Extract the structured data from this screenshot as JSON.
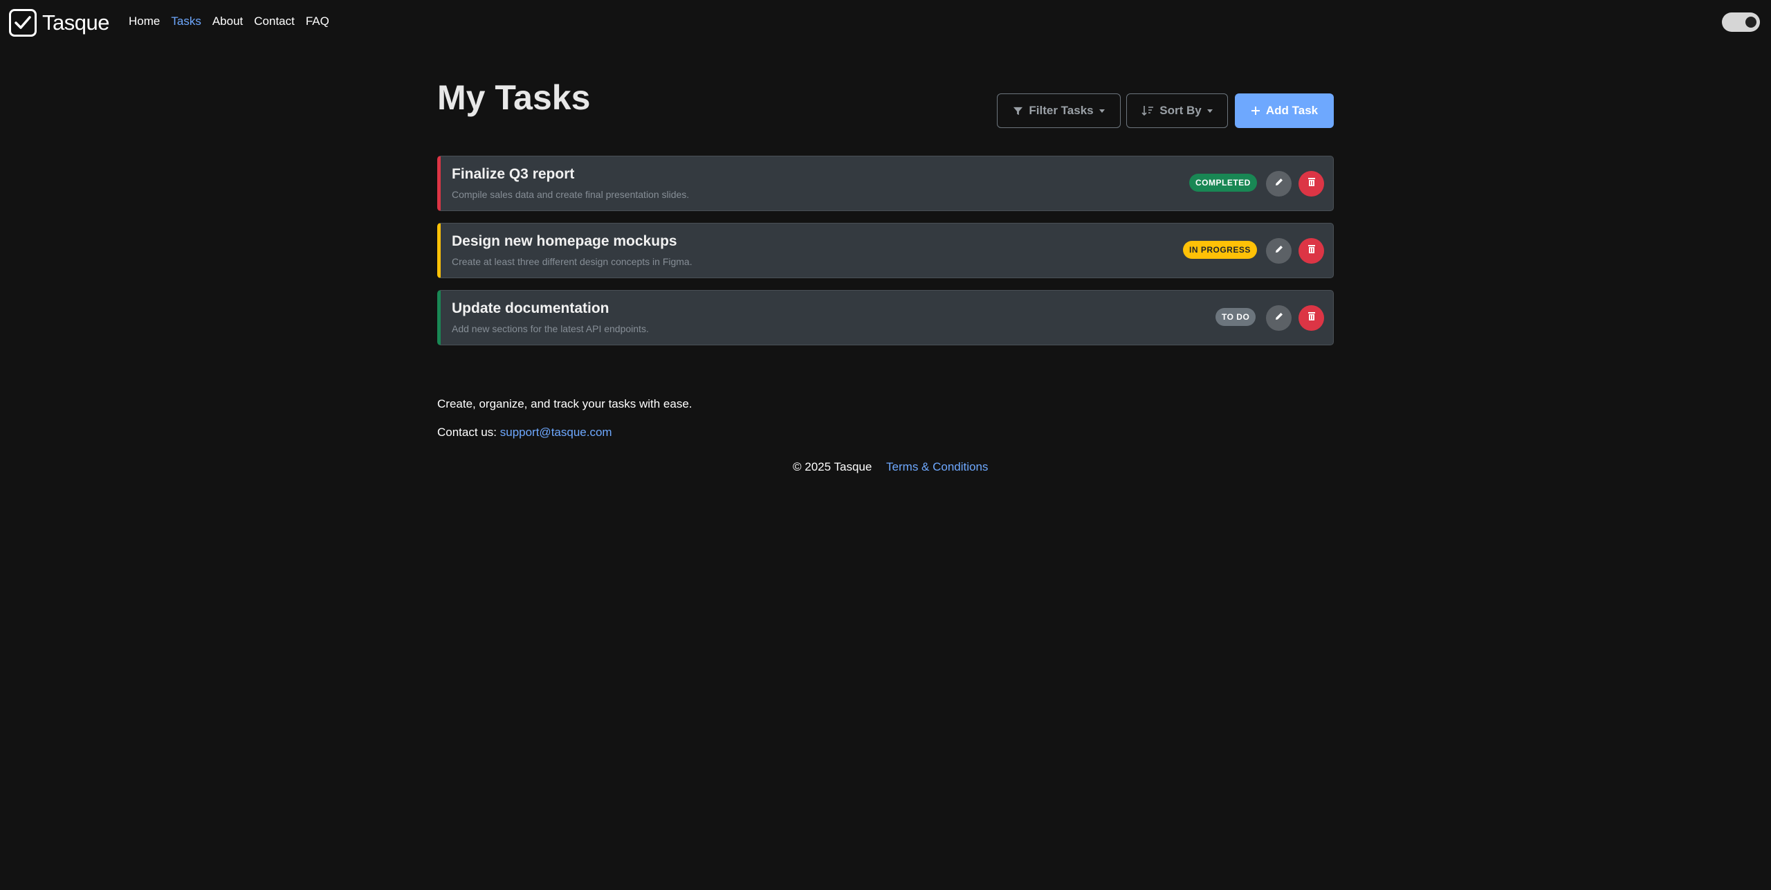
{
  "brand": {
    "name": "Tasque"
  },
  "nav": {
    "items": [
      {
        "label": "Home",
        "active": false
      },
      {
        "label": "Tasks",
        "active": true
      },
      {
        "label": "About",
        "active": false
      },
      {
        "label": "Contact",
        "active": false
      },
      {
        "label": "FAQ",
        "active": false
      }
    ],
    "theme_toggle": {
      "checked": true,
      "icon": "toggle-switch-icon"
    }
  },
  "main": {
    "title": "My Tasks",
    "toolbar": {
      "filter_label": "Filter Tasks",
      "sort_label": "Sort By",
      "add_label": "Add Task"
    },
    "tasks": [
      {
        "title": "Finalize Q3 report",
        "description": "Compile sales data and create final presentation slides.",
        "status": "COMPLETED",
        "accent": "#dc3545",
        "status_color": "#198754"
      },
      {
        "title": "Design new homepage mockups",
        "description": "Create at least three different design concepts in Figma.",
        "status": "IN PROGRESS",
        "accent": "#ffc107",
        "status_color": "#ffc107"
      },
      {
        "title": "Update documentation",
        "description": "Add new sections for the latest API endpoints.",
        "status": "TO DO",
        "accent": "#198754",
        "status_color": "#6c757d"
      }
    ]
  },
  "footer": {
    "tagline": "Create, organize, and track your tasks with ease.",
    "contact_prefix": "Contact us:",
    "contact_email": "support@tasque.com",
    "copyright": "© 2025 Tasque",
    "terms_label": "Terms & Conditions"
  },
  "colors": {
    "background": "#121212",
    "accent": "#6ea8fe",
    "card": "#343a40"
  }
}
